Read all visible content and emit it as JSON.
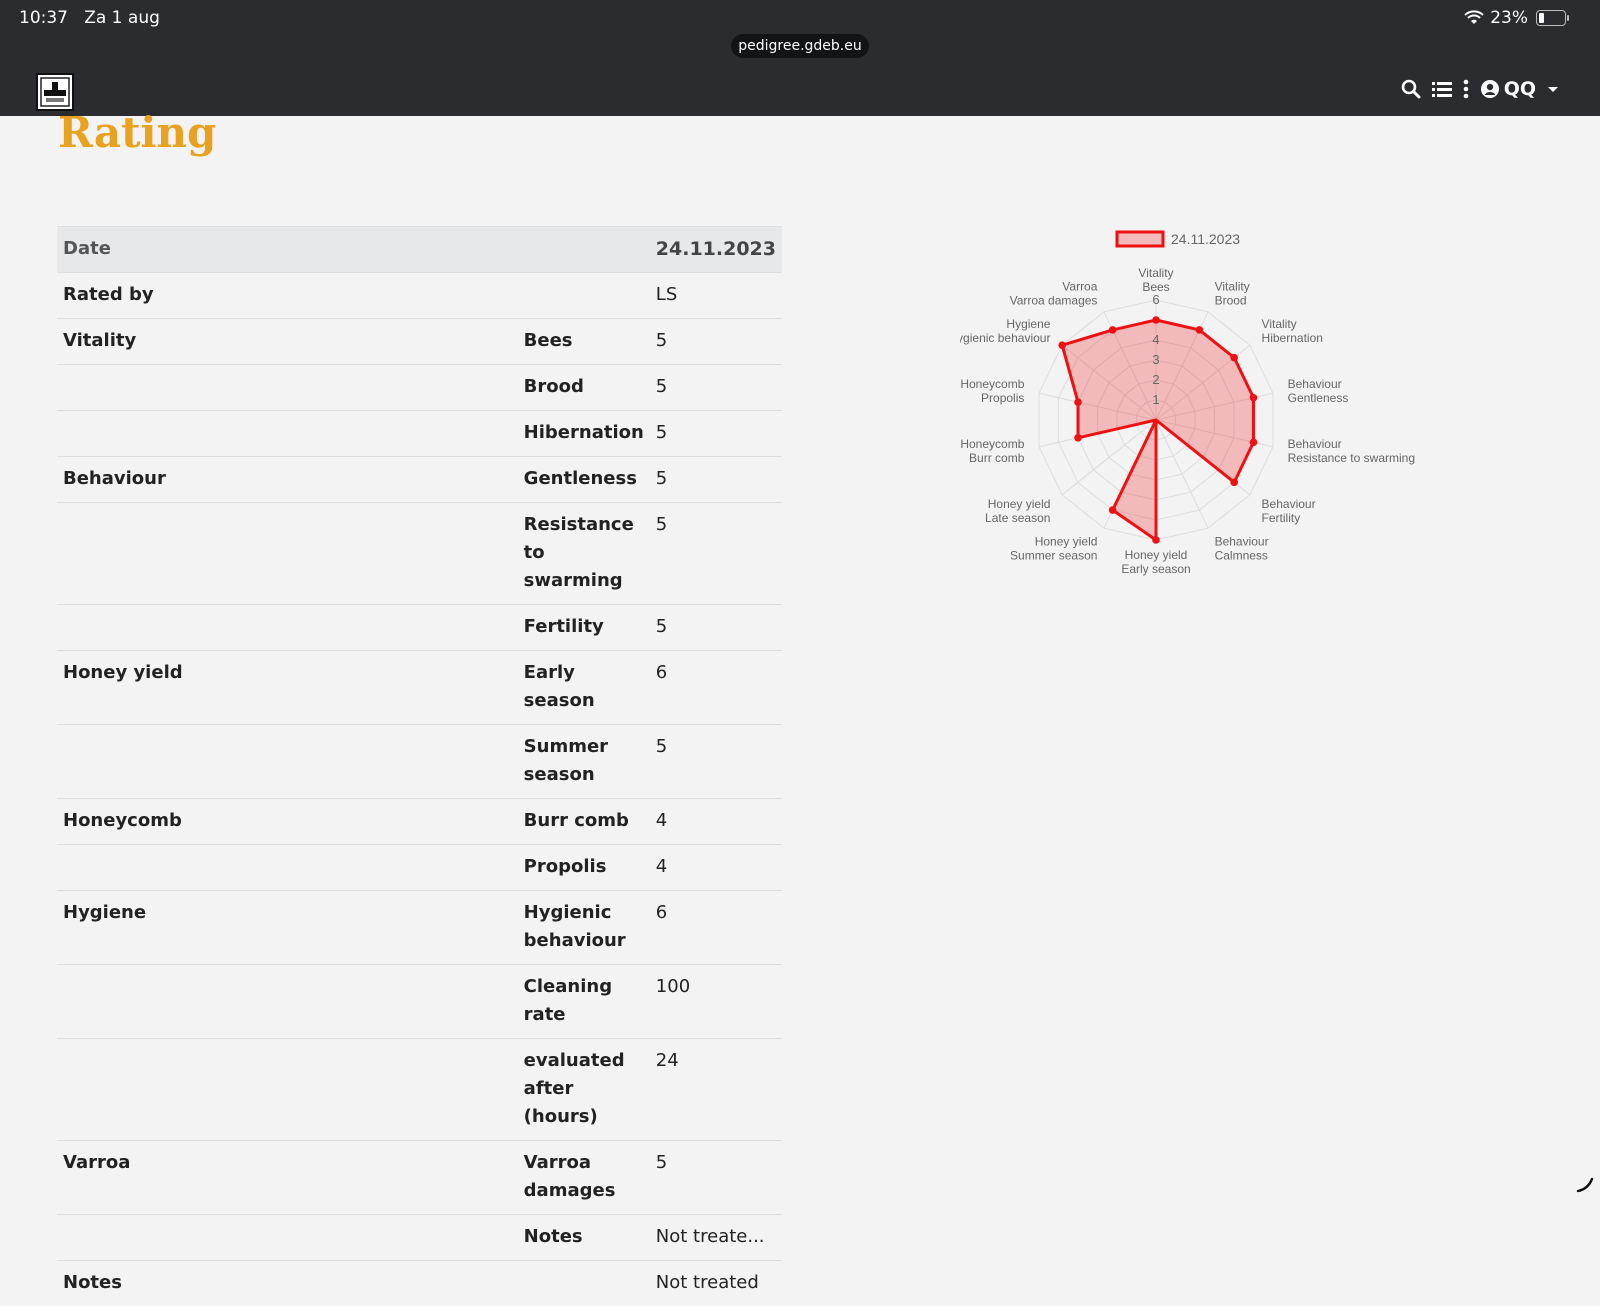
{
  "status": {
    "time": "10:37",
    "date": "Za 1 aug",
    "battery": "23%"
  },
  "browser": {
    "url": "pedigree.gdeb.eu"
  },
  "nav": {
    "user": "QQ"
  },
  "page": {
    "title": "Rating"
  },
  "table": {
    "header": {
      "label": "Date",
      "value": "24.11.2023"
    },
    "rows": [
      {
        "cat": "Rated by",
        "sub": "",
        "val": "LS"
      },
      {
        "cat": "Vitality",
        "sub": "Bees",
        "val": "5"
      },
      {
        "cat": "",
        "sub": "Brood",
        "val": "5"
      },
      {
        "cat": "",
        "sub": "Hibernation",
        "val": "5"
      },
      {
        "cat": "Behaviour",
        "sub": "Gentleness",
        "val": "5"
      },
      {
        "cat": "",
        "sub": "Resistance to swarming",
        "val": "5"
      },
      {
        "cat": "",
        "sub": "Fertility",
        "val": "5"
      },
      {
        "cat": "Honey yield",
        "sub": "Early season",
        "val": "6"
      },
      {
        "cat": "",
        "sub": "Summer season",
        "val": "5"
      },
      {
        "cat": "Honeycomb",
        "sub": "Burr comb",
        "val": "4"
      },
      {
        "cat": "",
        "sub": "Propolis",
        "val": "4"
      },
      {
        "cat": "Hygiene",
        "sub": "Hygienic behaviour",
        "val": "6"
      },
      {
        "cat": "",
        "sub": "Cleaning rate",
        "val": "100"
      },
      {
        "cat": "",
        "sub": "evaluated after (hours)",
        "val": "24"
      },
      {
        "cat": "Varroa",
        "sub": "Varroa damages",
        "val": "5"
      },
      {
        "cat": "",
        "sub": "Notes",
        "val": "Not treate..."
      },
      {
        "cat": "Notes",
        "sub": "",
        "val": "Not treated"
      }
    ]
  },
  "chart_data": {
    "type": "radar",
    "legend": [
      "24.11.2023"
    ],
    "legend_position": "top",
    "r_range": [
      0,
      6
    ],
    "r_ticks": [
      "1",
      "2",
      "3",
      "4",
      "6"
    ],
    "axes": [
      {
        "group": "Vitality",
        "name": "Bees"
      },
      {
        "group": "Vitality",
        "name": "Brood"
      },
      {
        "group": "Vitality",
        "name": "Hibernation"
      },
      {
        "group": "Behaviour",
        "name": "Gentleness"
      },
      {
        "group": "Behaviour",
        "name": "Resistance to swarming"
      },
      {
        "group": "Behaviour",
        "name": "Fertility"
      },
      {
        "group": "Behaviour",
        "name": "Calmness"
      },
      {
        "group": "Honey yield",
        "name": "Early season"
      },
      {
        "group": "Honey yield",
        "name": "Summer season"
      },
      {
        "group": "Honey yield",
        "name": "Late season"
      },
      {
        "group": "Honeycomb",
        "name": "Burr comb"
      },
      {
        "group": "Honeycomb",
        "name": "Propolis"
      },
      {
        "group": "Hygiene",
        "name": "Hygienic behaviour"
      },
      {
        "group": "Varroa",
        "name": "Varroa damages"
      }
    ],
    "series": [
      {
        "name": "24.11.2023",
        "values": [
          5,
          5,
          5,
          5,
          5,
          5,
          0,
          6,
          5,
          0,
          4,
          4,
          6,
          5
        ],
        "color": "#ee1111",
        "fill": "rgba(238,17,17,0.25)"
      }
    ],
    "grid": true
  }
}
